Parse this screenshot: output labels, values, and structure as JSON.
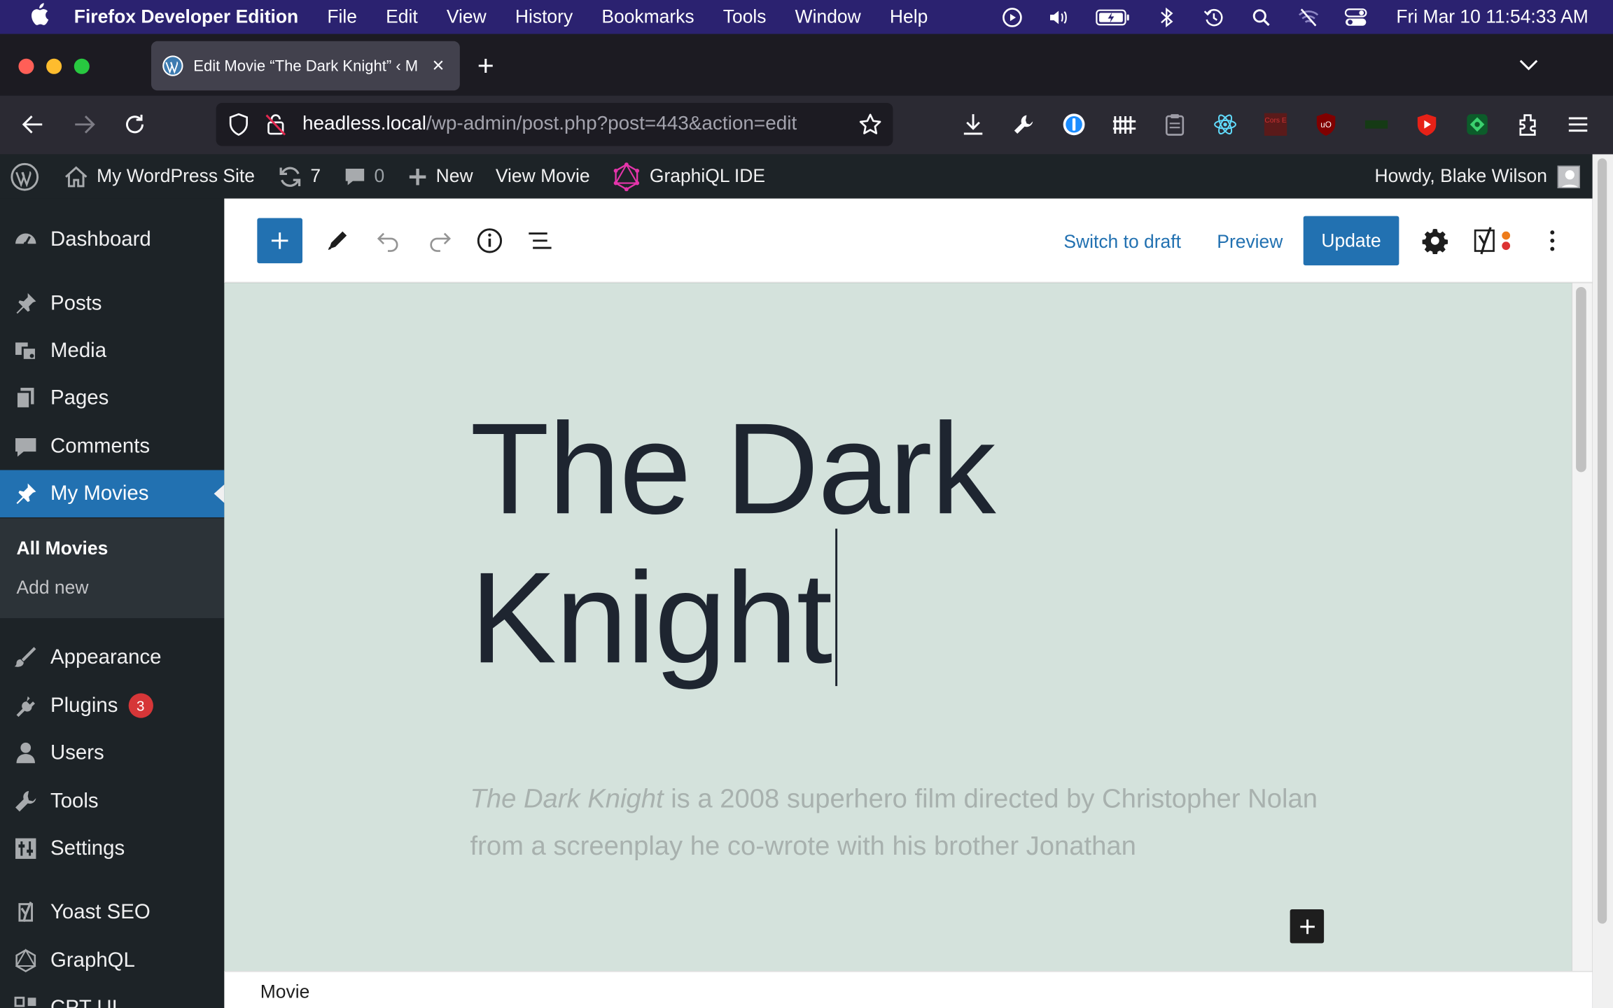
{
  "menubar": {
    "app_name": "Firefox Developer Edition",
    "items": [
      "File",
      "Edit",
      "View",
      "History",
      "Bookmarks",
      "Tools",
      "Window",
      "Help"
    ],
    "status_icons": [
      "play-circle-icon",
      "volume-icon",
      "battery-icon",
      "bluetooth-icon",
      "time-machine-icon",
      "spotlight-icon",
      "wifi-off-icon",
      "control-center-icon"
    ],
    "clock": "Fri Mar 10  11:54:33 AM"
  },
  "browser": {
    "tab_title": "Edit Movie “The Dark Knight” ‹ M",
    "url_host": "headless.local",
    "url_path": "/wp-admin/post.php?post=443&action=edit",
    "toolbar_icons": [
      "downloads-icon",
      "wrench-icon",
      "onepassword-icon",
      "library-icon",
      "clipboard-icon",
      "react-devtools-icon",
      "cors-extension-icon",
      "ublock-icon",
      "extension-icon",
      "youtube-extension-icon",
      "green-extension-icon",
      "extensions-icon",
      "hamburger-menu-icon"
    ],
    "cors_label": "Cors E"
  },
  "adminbar": {
    "site_name": "My WordPress Site",
    "updates_count": "7",
    "comments_count": "0",
    "new_label": "New",
    "view_label": "View Movie",
    "graphiql_label": "GraphiQL IDE",
    "howdy": "Howdy, Blake Wilson"
  },
  "sidebar": {
    "items": [
      {
        "label": "Dashboard",
        "icon": "dashboard-icon"
      },
      {
        "label": "Posts",
        "icon": "pin-icon"
      },
      {
        "label": "Media",
        "icon": "media-icon"
      },
      {
        "label": "Pages",
        "icon": "pages-icon"
      },
      {
        "label": "Comments",
        "icon": "comment-icon"
      },
      {
        "label": "My Movies",
        "icon": "pin-icon",
        "active": true
      },
      {
        "label": "Appearance",
        "icon": "brush-icon"
      },
      {
        "label": "Plugins",
        "icon": "plugin-icon",
        "badge": "3"
      },
      {
        "label": "Users",
        "icon": "user-icon"
      },
      {
        "label": "Tools",
        "icon": "wrench-icon"
      },
      {
        "label": "Settings",
        "icon": "settings-icon"
      },
      {
        "label": "Yoast SEO",
        "icon": "yoast-icon"
      },
      {
        "label": "GraphQL",
        "icon": "graphql-icon"
      },
      {
        "label": "CPT UI",
        "icon": "cpt-icon"
      }
    ],
    "submenu": [
      "All Movies",
      "Add new"
    ]
  },
  "editor": {
    "switch_draft": "Switch to draft",
    "preview": "Preview",
    "update": "Update",
    "title_line1": "The Dark",
    "title_line2": "Knight",
    "excerpt_em": "The Dark Knight",
    "excerpt_rest": " is a 2008 superhero film directed by Christopher Nolan from a screenplay he co-wrote with his brother Jonathan",
    "breadcrumb": "Movie"
  },
  "colors": {
    "wp_admin_dark": "#1d2327",
    "wp_blue": "#2271b1",
    "canvas_bg": "#d4e2dc",
    "macos_menubar": "#2b2270",
    "badge_red": "#d63638"
  }
}
